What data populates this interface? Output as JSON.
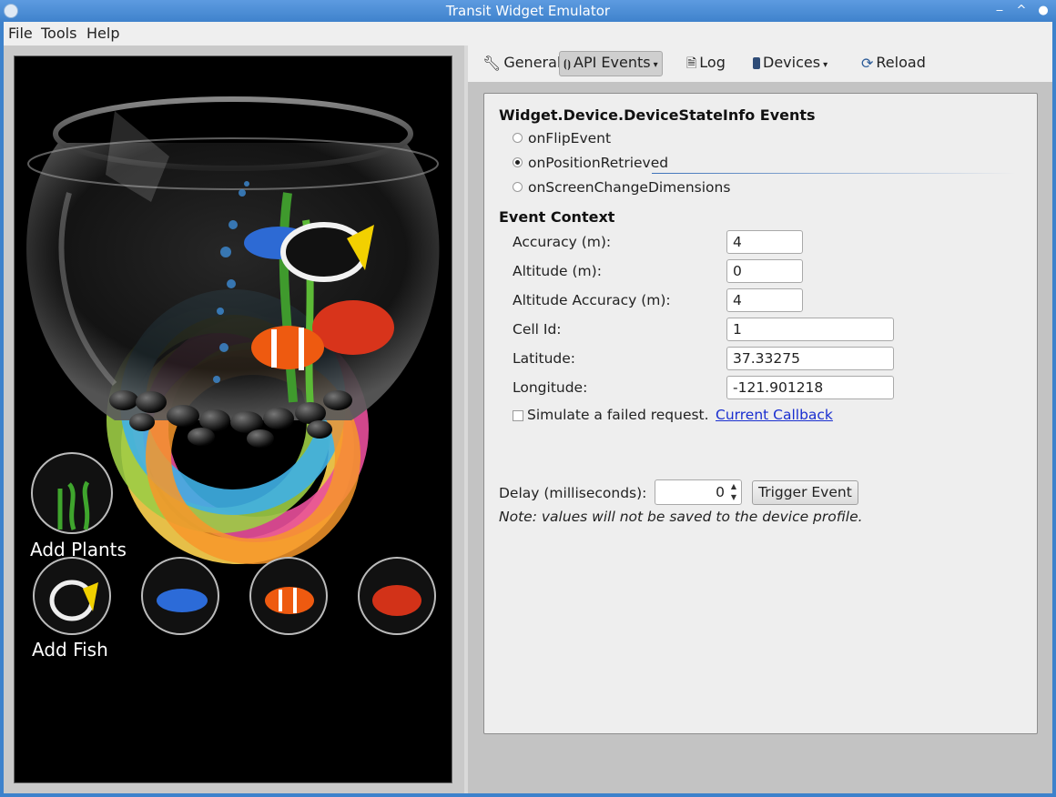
{
  "window": {
    "title": "Transit Widget Emulator"
  },
  "menu": {
    "items": [
      "File",
      "Tools",
      "Help"
    ]
  },
  "toolbar": {
    "general": "General",
    "api_events": "API Events",
    "log": "Log",
    "devices": "Devices",
    "reload": "Reload"
  },
  "events": {
    "heading": "Widget.Device.DeviceStateInfo Events",
    "options": [
      {
        "label": "onFlipEvent",
        "selected": false
      },
      {
        "label": "onPositionRetrieved",
        "selected": true
      },
      {
        "label": "onScreenChangeDimensions",
        "selected": false
      }
    ]
  },
  "context": {
    "heading": "Event Context",
    "fields": [
      {
        "label": "Accuracy (m):",
        "value": "4"
      },
      {
        "label": "Altitude (m):",
        "value": "0"
      },
      {
        "label": "Altitude Accuracy (m):",
        "value": "4"
      },
      {
        "label": "Cell Id:",
        "value": "1"
      },
      {
        "label": "Latitude:",
        "value": "37.33275"
      },
      {
        "label": "Longitude:",
        "value": "-121.901218"
      }
    ],
    "simulate_failed": {
      "label": "Simulate a failed request.",
      "checked": false
    },
    "callback_link": "Current Callback"
  },
  "delay": {
    "label": "Delay (milliseconds):",
    "value": "0"
  },
  "trigger_button": "Trigger Event",
  "note": "Note: values will not be saved to the device profile.",
  "widget": {
    "add_plants": "Add Plants",
    "add_fish": "Add Fish"
  },
  "colors": {
    "titlebar": "#3f82cc",
    "panel_bg": "#eeeeee",
    "link": "#1a2fd0",
    "widget_bg": "#000000"
  }
}
